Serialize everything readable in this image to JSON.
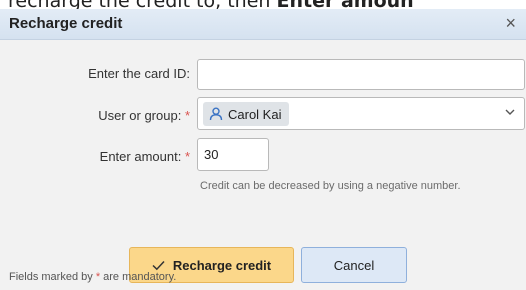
{
  "instruction": {
    "prefix": "recharge the credit to, then ",
    "emphasis": "Enter amoun"
  },
  "dialog": {
    "title": "Recharge credit",
    "close_symbol": "×"
  },
  "form": {
    "card_id": {
      "label": "Enter the card ID:",
      "value": ""
    },
    "user_group": {
      "label": "User or group:",
      "required_mark": "*",
      "selected": "Carol Kai",
      "chip_icon": "user-icon"
    },
    "amount": {
      "label": "Enter amount:",
      "required_mark": "*",
      "value": "30"
    },
    "amount_hint": "Credit can be decreased by using a negative number."
  },
  "buttons": {
    "recharge_label": "Recharge credit",
    "recharge_icon": "check-icon",
    "cancel_label": "Cancel"
  },
  "footer": {
    "prefix": "Fields marked by ",
    "mark": "*",
    "suffix": " are mandatory."
  },
  "colors": {
    "primary_button": "#fbd78a",
    "secondary_button": "#dde8f6",
    "required": "#d9534f",
    "titlebar": "#d5e2f0"
  }
}
